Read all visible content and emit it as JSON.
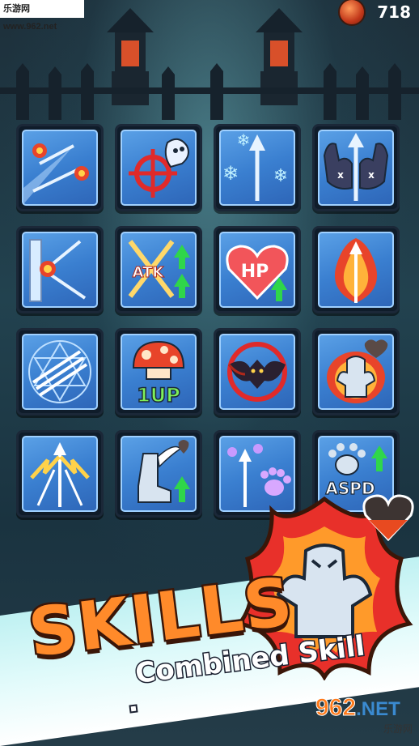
{
  "header": {
    "watermark_top": "乐游网 www.962.net",
    "coin_icon": "coin-icon",
    "coin_value": "718"
  },
  "skills_grid": [
    {
      "icon": "double-fire-arrow-icon"
    },
    {
      "icon": "crosshair-ghost-icon"
    },
    {
      "icon": "frost-arrow-icon"
    },
    {
      "icon": "horned-helmet-arrow-icon"
    },
    {
      "icon": "wall-bounce-arrow-icon"
    },
    {
      "icon": "atk-up-icon",
      "label": "ATK"
    },
    {
      "icon": "hp-up-icon",
      "label": "HP"
    },
    {
      "icon": "flame-arrow-icon"
    },
    {
      "icon": "magic-circle-arrow-icon"
    },
    {
      "icon": "one-up-mushroom-icon",
      "label": "1UP"
    },
    {
      "icon": "bat-demon-icon"
    },
    {
      "icon": "rage-statue-icon"
    },
    {
      "icon": "lightning-arrows-icon"
    },
    {
      "icon": "winged-boots-icon"
    },
    {
      "icon": "paw-arrow-icon"
    },
    {
      "icon": "aspd-up-icon",
      "label": "ASPD"
    }
  ],
  "banner": {
    "title": "SKILLS",
    "subtitle": "Combined Skill",
    "watermark_bottom_num": "962",
    "watermark_bottom_net": ".NET",
    "watermark_bottom_cn": "乐游网"
  },
  "colors": {
    "title_orange": "#ff8a2a",
    "tile_blue": "#3a7fd0",
    "up_arrow_green": "#2fd64a"
  }
}
